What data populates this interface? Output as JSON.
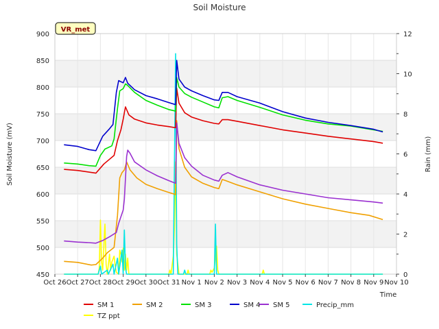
{
  "chart_data": {
    "type": "line",
    "title": "Soil Moisture",
    "station_label": "VR_met",
    "xlabel": "Time",
    "ylabel": "Soil Moisture (mV)",
    "y2label": "Rain (mm)",
    "x_tick_labels": [
      "Oct 26",
      "Oct 27",
      "Oct 28",
      "Oct 29",
      "Oct 30",
      "Oct 31",
      "Nov 1",
      "Nov 2",
      "Nov 3",
      "Nov 4",
      "Nov 5",
      "Nov 6",
      "Nov 7",
      "Nov 8",
      "Nov 9",
      "Nov 10"
    ],
    "xlim": [
      0,
      15
    ],
    "ylim": [
      450,
      900
    ],
    "y_ticks": [
      450,
      500,
      550,
      600,
      650,
      700,
      750,
      800,
      850,
      900
    ],
    "y2lim": [
      0,
      12
    ],
    "y2_ticks": [
      0,
      2,
      4,
      6,
      8,
      10,
      12
    ],
    "grid": true,
    "legend_position": "bottom",
    "series": [
      {
        "name": "SM 1",
        "axis": "left",
        "color": "#e00000",
        "points": [
          [
            0.4,
            646
          ],
          [
            1.0,
            644
          ],
          [
            1.8,
            639
          ],
          [
            2.15,
            656
          ],
          [
            2.4,
            665
          ],
          [
            2.6,
            672
          ],
          [
            2.75,
            700
          ],
          [
            2.9,
            720
          ],
          [
            3.0,
            740
          ],
          [
            3.1,
            763
          ],
          [
            3.25,
            748
          ],
          [
            3.5,
            740
          ],
          [
            4.0,
            733
          ],
          [
            4.5,
            729
          ],
          [
            5.0,
            726
          ],
          [
            5.3,
            724
          ],
          [
            5.35,
            798
          ],
          [
            5.45,
            770
          ],
          [
            5.7,
            752
          ],
          [
            6.0,
            744
          ],
          [
            6.5,
            737
          ],
          [
            7.0,
            732
          ],
          [
            7.2,
            731
          ],
          [
            7.35,
            739
          ],
          [
            7.6,
            739
          ],
          [
            8.0,
            736
          ],
          [
            9.0,
            728
          ],
          [
            10.0,
            720
          ],
          [
            11.0,
            714
          ],
          [
            12.0,
            708
          ],
          [
            13.0,
            703
          ],
          [
            14.0,
            698
          ],
          [
            14.4,
            695
          ]
        ]
      },
      {
        "name": "SM 2",
        "axis": "left",
        "color": "#f0a000",
        "points": [
          [
            0.4,
            474
          ],
          [
            1.0,
            472
          ],
          [
            1.6,
            467
          ],
          [
            1.8,
            468
          ],
          [
            2.1,
            480
          ],
          [
            2.3,
            490
          ],
          [
            2.6,
            500
          ],
          [
            2.75,
            560
          ],
          [
            2.85,
            630
          ],
          [
            2.95,
            640
          ],
          [
            3.05,
            645
          ],
          [
            3.15,
            660
          ],
          [
            3.3,
            645
          ],
          [
            3.6,
            630
          ],
          [
            4.0,
            618
          ],
          [
            4.5,
            610
          ],
          [
            5.0,
            603
          ],
          [
            5.3,
            599
          ],
          [
            5.35,
            737
          ],
          [
            5.45,
            685
          ],
          [
            5.7,
            650
          ],
          [
            6.0,
            632
          ],
          [
            6.5,
            620
          ],
          [
            7.0,
            612
          ],
          [
            7.2,
            610
          ],
          [
            7.35,
            627
          ],
          [
            7.5,
            625
          ],
          [
            8.0,
            617
          ],
          [
            9.0,
            604
          ],
          [
            10.0,
            591
          ],
          [
            11.0,
            581
          ],
          [
            12.0,
            573
          ],
          [
            13.0,
            565
          ],
          [
            13.8,
            560
          ],
          [
            14.4,
            552
          ]
        ]
      },
      {
        "name": "SM 3",
        "axis": "left",
        "color": "#00e000",
        "points": [
          [
            0.4,
            658
          ],
          [
            1.0,
            656
          ],
          [
            1.5,
            653
          ],
          [
            1.8,
            652
          ],
          [
            2.0,
            672
          ],
          [
            2.2,
            684
          ],
          [
            2.5,
            690
          ],
          [
            2.6,
            703
          ],
          [
            2.75,
            760
          ],
          [
            2.85,
            793
          ],
          [
            3.0,
            797
          ],
          [
            3.1,
            806
          ],
          [
            3.2,
            803
          ],
          [
            3.5,
            790
          ],
          [
            4.0,
            775
          ],
          [
            4.5,
            766
          ],
          [
            5.0,
            758
          ],
          [
            5.3,
            755
          ],
          [
            5.35,
            818
          ],
          [
            5.45,
            800
          ],
          [
            5.7,
            788
          ],
          [
            6.0,
            781
          ],
          [
            6.5,
            772
          ],
          [
            7.0,
            763
          ],
          [
            7.2,
            761
          ],
          [
            7.35,
            780
          ],
          [
            7.6,
            782
          ],
          [
            8.0,
            775
          ],
          [
            9.0,
            762
          ],
          [
            10.0,
            748
          ],
          [
            11.0,
            738
          ],
          [
            12.0,
            731
          ],
          [
            13.0,
            727
          ],
          [
            14.0,
            720
          ],
          [
            14.4,
            717
          ]
        ]
      },
      {
        "name": "SM 4",
        "axis": "left",
        "color": "#0000cc",
        "points": [
          [
            0.4,
            692
          ],
          [
            1.0,
            689
          ],
          [
            1.5,
            683
          ],
          [
            1.8,
            681
          ],
          [
            2.1,
            708
          ],
          [
            2.4,
            722
          ],
          [
            2.55,
            730
          ],
          [
            2.7,
            790
          ],
          [
            2.8,
            812
          ],
          [
            3.0,
            808
          ],
          [
            3.1,
            818
          ],
          [
            3.2,
            807
          ],
          [
            3.5,
            795
          ],
          [
            4.0,
            784
          ],
          [
            4.5,
            778
          ],
          [
            5.0,
            771
          ],
          [
            5.3,
            767
          ],
          [
            5.35,
            850
          ],
          [
            5.45,
            815
          ],
          [
            5.7,
            800
          ],
          [
            6.0,
            793
          ],
          [
            6.5,
            784
          ],
          [
            7.0,
            776
          ],
          [
            7.2,
            775
          ],
          [
            7.35,
            790
          ],
          [
            7.6,
            790
          ],
          [
            8.0,
            782
          ],
          [
            9.0,
            770
          ],
          [
            10.0,
            754
          ],
          [
            11.0,
            742
          ],
          [
            12.0,
            734
          ],
          [
            13.0,
            728
          ],
          [
            14.0,
            721
          ],
          [
            14.4,
            716
          ]
        ]
      },
      {
        "name": "SM 5",
        "axis": "left",
        "color": "#9a30d0",
        "points": [
          [
            0.4,
            512
          ],
          [
            1.0,
            510
          ],
          [
            1.5,
            509
          ],
          [
            1.8,
            508
          ],
          [
            2.1,
            513
          ],
          [
            2.4,
            520
          ],
          [
            2.7,
            528
          ],
          [
            2.8,
            545
          ],
          [
            3.0,
            570
          ],
          [
            3.05,
            590
          ],
          [
            3.15,
            670
          ],
          [
            3.2,
            682
          ],
          [
            3.3,
            676
          ],
          [
            3.5,
            660
          ],
          [
            4.0,
            645
          ],
          [
            4.5,
            634
          ],
          [
            5.0,
            625
          ],
          [
            5.3,
            620
          ],
          [
            5.35,
            733
          ],
          [
            5.45,
            695
          ],
          [
            5.7,
            668
          ],
          [
            6.0,
            652
          ],
          [
            6.5,
            635
          ],
          [
            7.0,
            626
          ],
          [
            7.2,
            624
          ],
          [
            7.35,
            635
          ],
          [
            7.6,
            640
          ],
          [
            8.0,
            632
          ],
          [
            9.0,
            617
          ],
          [
            10.0,
            607
          ],
          [
            11.0,
            600
          ],
          [
            12.0,
            593
          ],
          [
            13.0,
            589
          ],
          [
            14.0,
            585
          ],
          [
            14.4,
            583
          ]
        ]
      },
      {
        "name": "Precip_mm",
        "axis": "right",
        "color": "#00e5e5",
        "points": [
          [
            0.4,
            0
          ],
          [
            1.9,
            0
          ],
          [
            2.0,
            0.4
          ],
          [
            2.05,
            0
          ],
          [
            2.3,
            0.2
          ],
          [
            2.35,
            0
          ],
          [
            2.55,
            0.5
          ],
          [
            2.6,
            0
          ],
          [
            2.75,
            0.8
          ],
          [
            2.8,
            0
          ],
          [
            2.95,
            1.2
          ],
          [
            3.0,
            0
          ],
          [
            3.05,
            2.2
          ],
          [
            3.1,
            0.3
          ],
          [
            3.15,
            0
          ],
          [
            5.2,
            0
          ],
          [
            5.3,
            11
          ],
          [
            5.35,
            1.5
          ],
          [
            5.4,
            0
          ],
          [
            5.65,
            0
          ],
          [
            5.7,
            0.2
          ],
          [
            5.75,
            0
          ],
          [
            7.0,
            0
          ],
          [
            7.05,
            2.5
          ],
          [
            7.1,
            0
          ],
          [
            14.4,
            0
          ]
        ]
      },
      {
        "name": "TZ ppt",
        "axis": "right",
        "color": "#ffff00",
        "points": [
          [
            0.4,
            0
          ],
          [
            1.9,
            0
          ],
          [
            1.95,
            0.3
          ],
          [
            2.0,
            2.7
          ],
          [
            2.05,
            0.6
          ],
          [
            2.1,
            0.2
          ],
          [
            2.2,
            2.5
          ],
          [
            2.25,
            0.5
          ],
          [
            2.3,
            0
          ],
          [
            2.4,
            1.0
          ],
          [
            2.45,
            0.2
          ],
          [
            2.5,
            0.6
          ],
          [
            2.6,
            0.9
          ],
          [
            2.65,
            0.4
          ],
          [
            2.7,
            0.1
          ],
          [
            2.8,
            0
          ],
          [
            2.85,
            1.2
          ],
          [
            2.9,
            1.0
          ],
          [
            2.95,
            0.6
          ],
          [
            3.0,
            1.3
          ],
          [
            3.05,
            0.2
          ],
          [
            3.1,
            1.0
          ],
          [
            3.15,
            0.2
          ],
          [
            3.2,
            0.8
          ],
          [
            3.25,
            0
          ],
          [
            5.0,
            0
          ],
          [
            5.05,
            0.2
          ],
          [
            5.1,
            0
          ],
          [
            5.2,
            0.9
          ],
          [
            5.25,
            2.3
          ],
          [
            5.3,
            5.6
          ],
          [
            5.35,
            1.0
          ],
          [
            5.4,
            0.5
          ],
          [
            5.45,
            0
          ],
          [
            5.5,
            0
          ],
          [
            5.8,
            0
          ],
          [
            5.85,
            0.2
          ],
          [
            5.9,
            0
          ],
          [
            6.8,
            0
          ],
          [
            6.85,
            0.2
          ],
          [
            6.9,
            0.1
          ],
          [
            7.0,
            0.3
          ],
          [
            7.1,
            1.4
          ],
          [
            7.15,
            0.2
          ],
          [
            7.2,
            0
          ],
          [
            9.1,
            0
          ],
          [
            9.15,
            0.2
          ],
          [
            9.2,
            0
          ],
          [
            14.4,
            0
          ]
        ]
      }
    ]
  }
}
